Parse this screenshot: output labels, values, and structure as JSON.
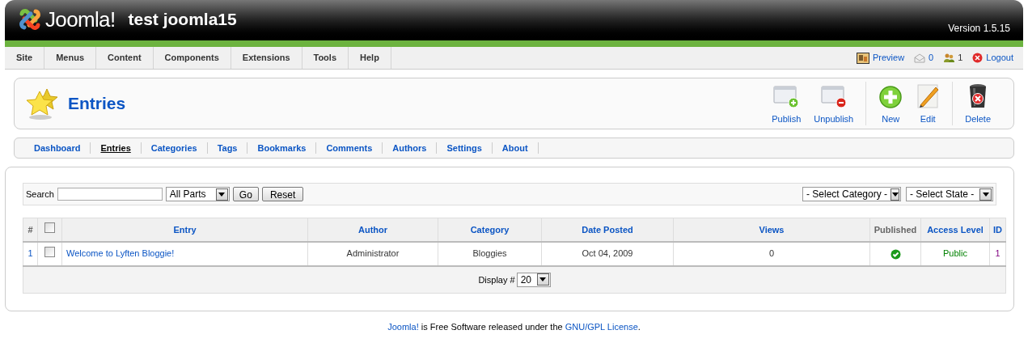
{
  "header": {
    "logo_text": "Joomla!",
    "site_title": "test joomla15",
    "version": "Version 1.5.15"
  },
  "menu": [
    "Site",
    "Menus",
    "Content",
    "Components",
    "Extensions",
    "Tools",
    "Help"
  ],
  "status": {
    "preview": "Preview",
    "messages": "0",
    "users": "1",
    "logout": "Logout"
  },
  "page_title": "Entries",
  "toolbar": [
    {
      "label": "Publish",
      "kind": "publish",
      "separated_before": false
    },
    {
      "label": "Unpublish",
      "kind": "unpublish",
      "separated_before": false
    },
    {
      "label": "New",
      "kind": "new",
      "separated_before": true
    },
    {
      "label": "Edit",
      "kind": "edit",
      "separated_before": false
    },
    {
      "label": "Delete",
      "kind": "delete",
      "separated_before": true
    }
  ],
  "submenu": [
    {
      "label": "Dashboard",
      "selected": false
    },
    {
      "label": "Entries",
      "selected": true
    },
    {
      "label": "Categories",
      "selected": false
    },
    {
      "label": "Tags",
      "selected": false
    },
    {
      "label": "Bookmarks",
      "selected": false
    },
    {
      "label": "Comments",
      "selected": false
    },
    {
      "label": "Authors",
      "selected": false
    },
    {
      "label": "Settings",
      "selected": false
    },
    {
      "label": "About",
      "selected": false
    }
  ],
  "filters": {
    "search_label": "Search",
    "parts_select": "All Parts",
    "go": "Go",
    "reset": "Reset",
    "category_select": "- Select Category -",
    "state_select": "- Select State -"
  },
  "table": {
    "columns": [
      {
        "label": "#",
        "kind": "plain"
      },
      {
        "kind": "checkbox",
        "checked": false
      },
      {
        "label": "Entry",
        "kind": "link"
      },
      {
        "label": "Author",
        "kind": "link"
      },
      {
        "label": "Category",
        "kind": "link"
      },
      {
        "label": "Date Posted",
        "kind": "link"
      },
      {
        "label": "Views",
        "kind": "link"
      },
      {
        "label": "Published",
        "kind": "plain"
      },
      {
        "label": "Access Level",
        "kind": "link"
      },
      {
        "label": "ID",
        "kind": "link"
      }
    ],
    "rows": [
      {
        "number": "1",
        "checked": false,
        "entry": "Welcome to Lyften Bloggie!",
        "author": "Administrator",
        "category": "Bloggies",
        "date": "Oct 04, 2009",
        "views": "0",
        "published": true,
        "access": "Public",
        "id": "1"
      }
    ]
  },
  "pagination": {
    "label": "Display #",
    "value": "20"
  },
  "footer": {
    "link": "Joomla!",
    "text": " is Free Software released under the ",
    "license": "GNU/GPL License",
    "end": "."
  }
}
